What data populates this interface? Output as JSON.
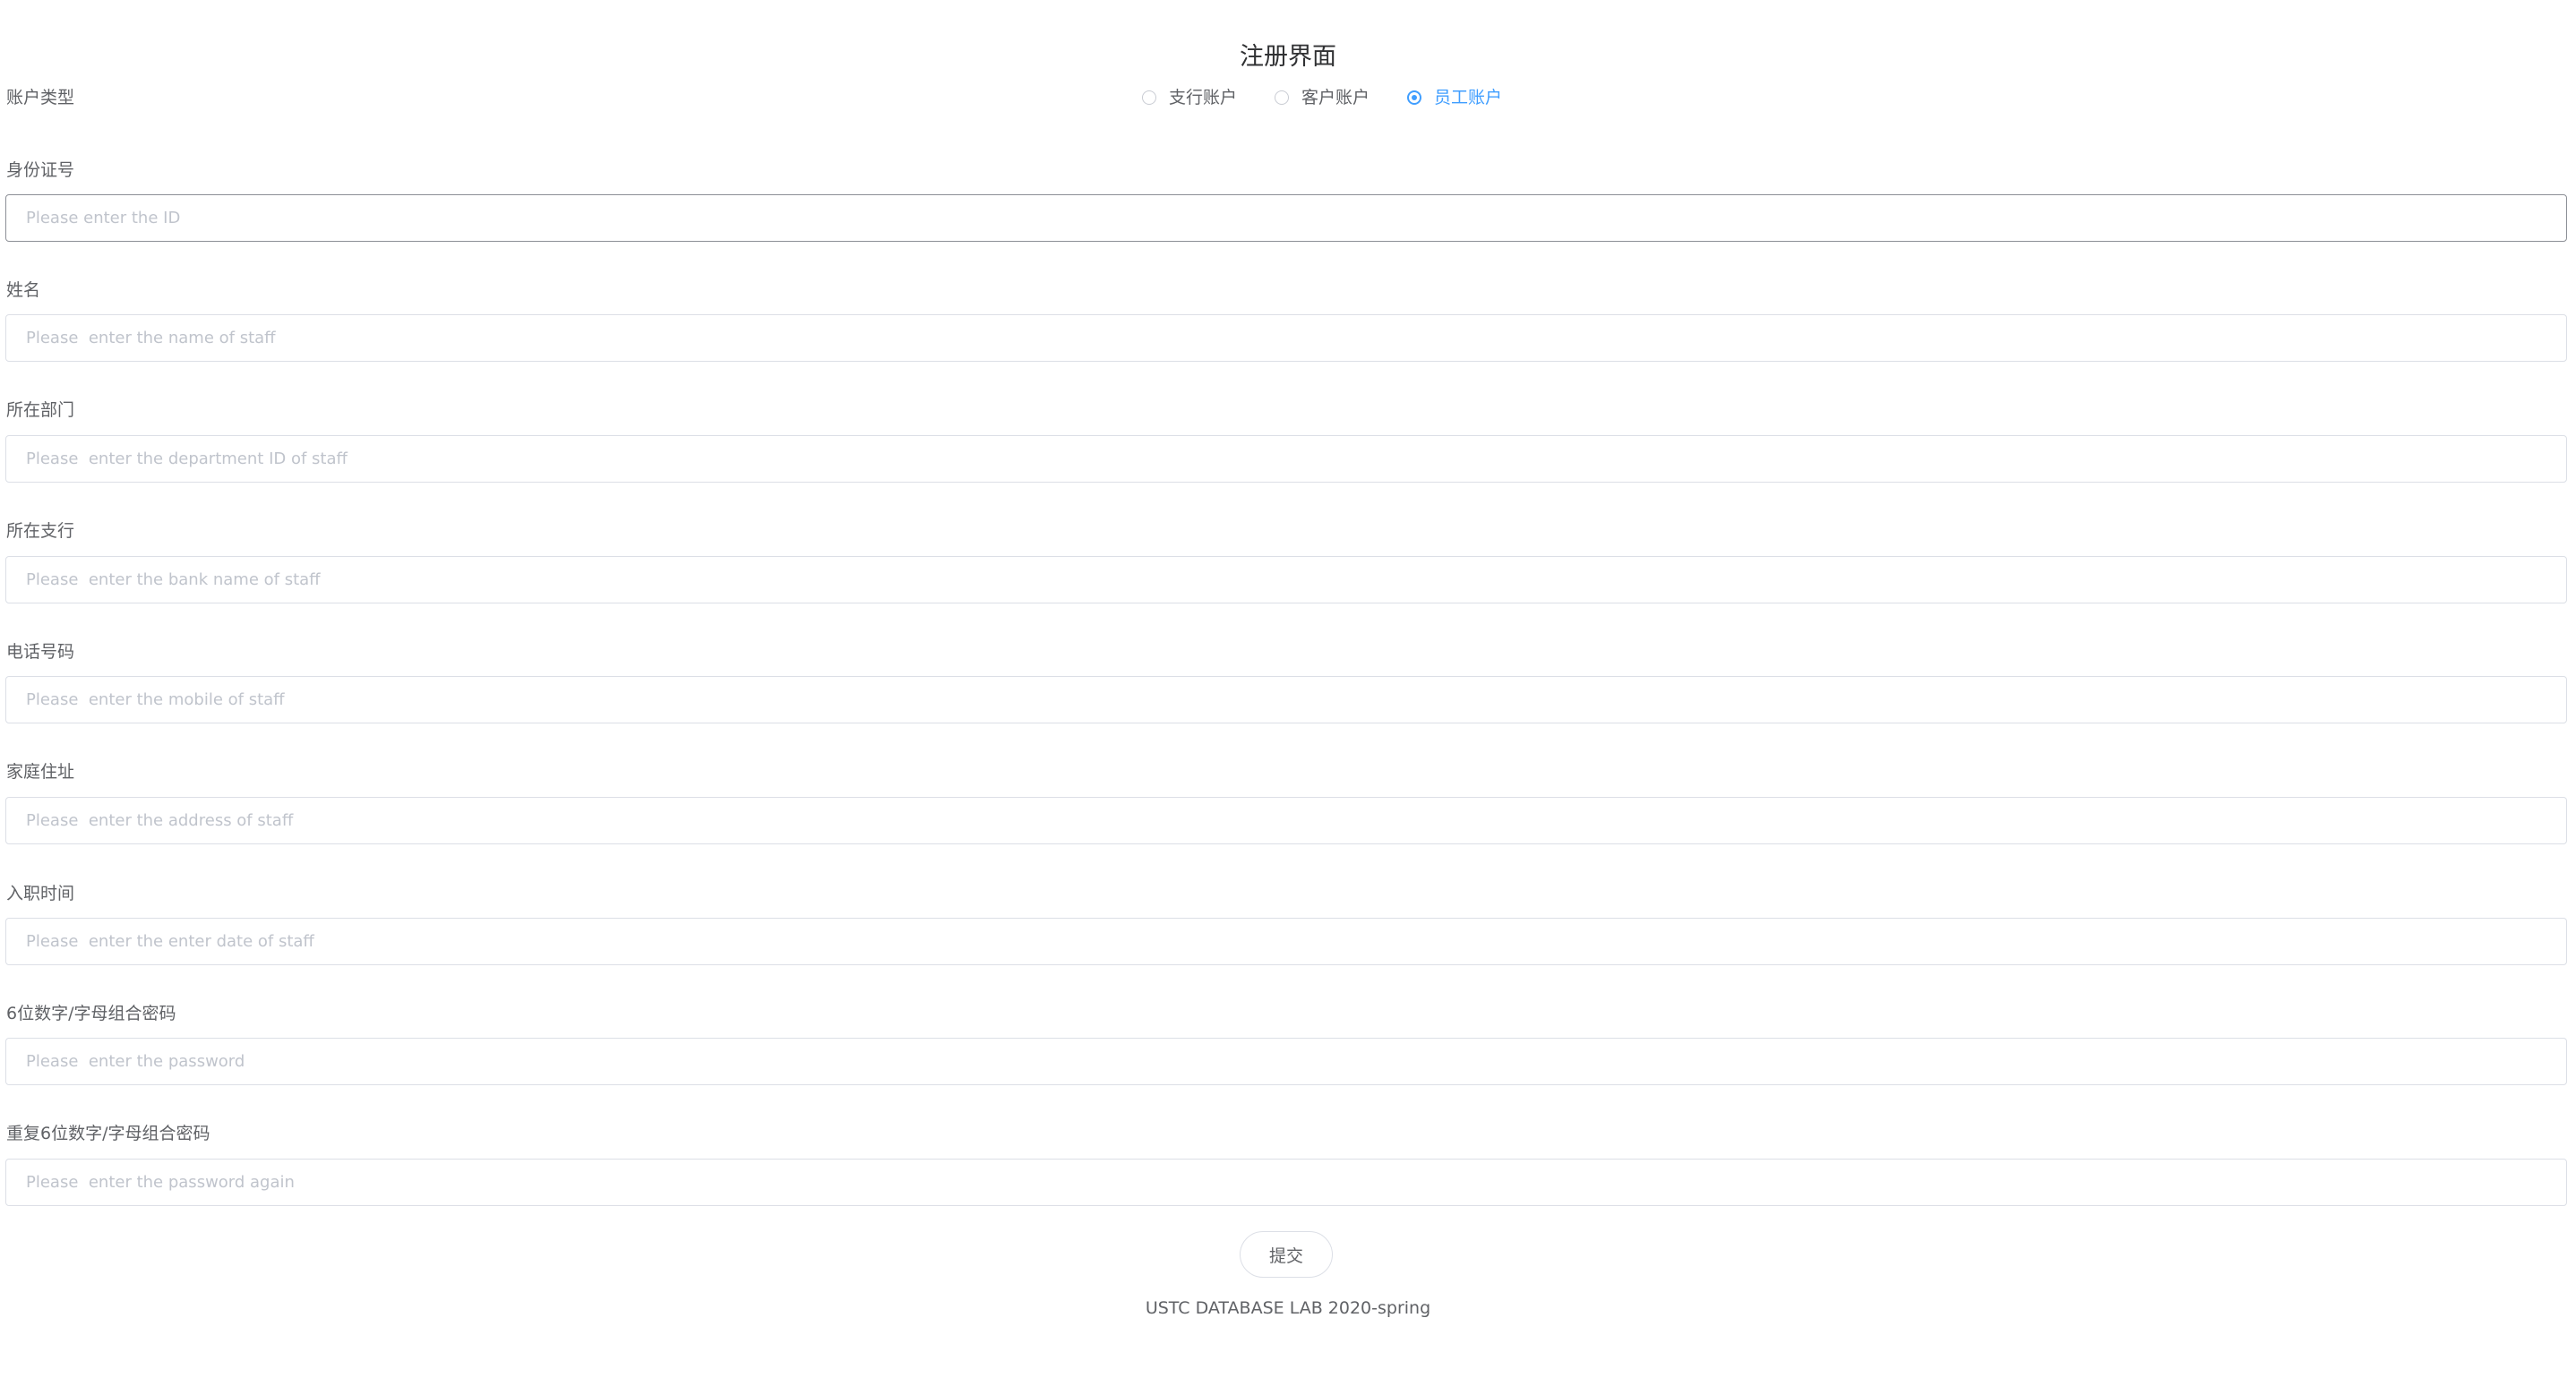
{
  "page": {
    "title": "注册界面",
    "footer": "USTC DATABASE LAB 2020-spring"
  },
  "account_type": {
    "label": "账户类型",
    "options": [
      "支行账户",
      "客户账户",
      "员工账户"
    ],
    "selected": "员工账户"
  },
  "fields": [
    {
      "label": "身份证号",
      "placeholder": "Please enter the ID",
      "value": ""
    },
    {
      "label": "姓名",
      "placeholder": "Please  enter the name of staff",
      "value": ""
    },
    {
      "label": "所在部门",
      "placeholder": "Please  enter the department ID of staff",
      "value": ""
    },
    {
      "label": "所在支行",
      "placeholder": "Please  enter the bank name of staff",
      "value": ""
    },
    {
      "label": "电话号码",
      "placeholder": "Please  enter the mobile of staff",
      "value": ""
    },
    {
      "label": "家庭住址",
      "placeholder": "Please  enter the address of staff",
      "value": ""
    },
    {
      "label": "入职时间",
      "placeholder": "Please  enter the enter date of staff",
      "value": ""
    },
    {
      "label": "6位数字/字母组合密码",
      "placeholder": "Please  enter the password",
      "value": ""
    },
    {
      "label": "重复6位数字/字母组合密码",
      "placeholder": "Please  enter the password again",
      "value": ""
    }
  ],
  "submit": {
    "label": "提交"
  },
  "colors": {
    "accent": "#409eff",
    "text": "#606266",
    "placeholder": "#c0c4cc",
    "border": "#dcdfe6"
  }
}
